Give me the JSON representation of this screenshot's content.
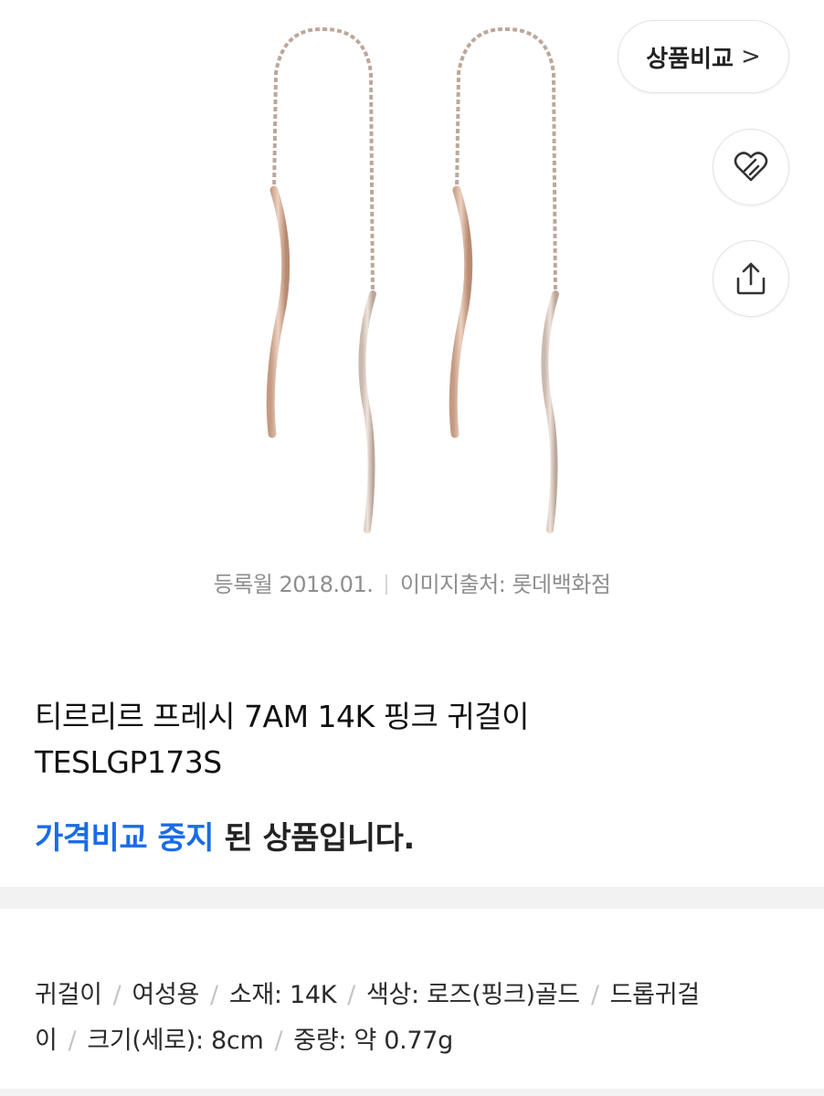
{
  "product": {
    "image_alt": "rose gold wave threader earrings",
    "registered": "등록월 2018.01.",
    "image_source": "이미지출처: 롯데백화점",
    "title_line1": "티르리르 프레시 7AM 14K 핑크 귀걸이",
    "title_line2": "TESLGP173S",
    "status_highlight": "가격비교 중지",
    "status_rest": " 된 상품입니다.",
    "specs": [
      "귀걸이",
      "여성용",
      "소재: 14K",
      "색상: 로즈(핑크)골드",
      "드롭귀걸이",
      "크기(세로): 8cm",
      "중량: 약 0.77g"
    ],
    "spec_wrap_tail": "이"
  },
  "actions": {
    "compare_label": "상품비교",
    "compare_chevron": ">",
    "favorite_icon": "heart-icon",
    "share_icon": "share-icon"
  },
  "colors": {
    "accent": "#1a6be8",
    "chain": "#c9b3a6",
    "gold": "#d9b39a"
  }
}
